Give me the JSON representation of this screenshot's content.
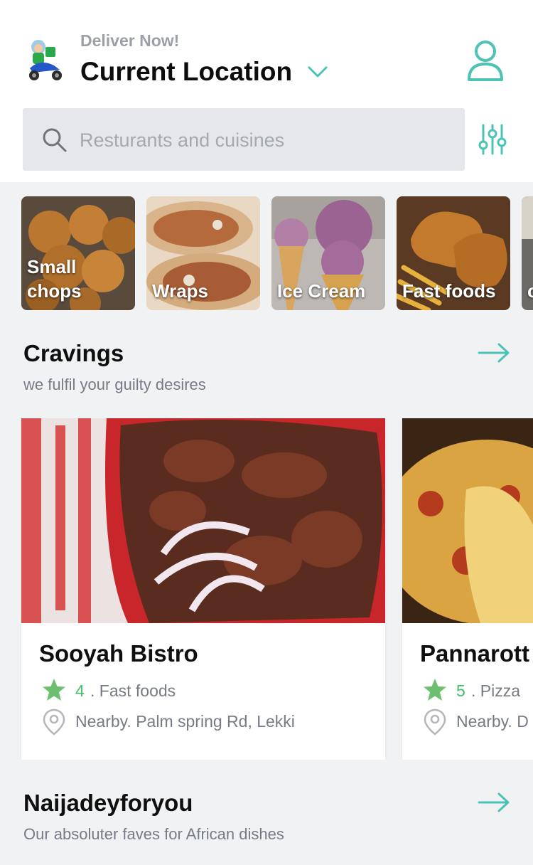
{
  "header": {
    "deliver_label": "Deliver Now!",
    "location_label": "Current Location"
  },
  "search": {
    "placeholder": "Resturants and cuisines"
  },
  "categories": [
    {
      "label": "Small chops"
    },
    {
      "label": "Wraps"
    },
    {
      "label": "Ice Cream"
    },
    {
      "label": "Fast foods"
    },
    {
      "label": "c c"
    }
  ],
  "sections": [
    {
      "title": "Cravings",
      "subtitle": "we fulfil your guilty desires",
      "restaurants": [
        {
          "name": "Sooyah Bistro",
          "rating": "4",
          "category": ". Fast foods",
          "address": "Nearby. Palm spring Rd, Lekki"
        },
        {
          "name": "Pannarott",
          "rating": "5",
          "category": ". Pizza",
          "address": "Nearby. D"
        }
      ]
    },
    {
      "title": "Naijadeyforyou",
      "subtitle": "Our absoluter faves for African dishes"
    }
  ],
  "colors": {
    "accent": "#4cc3b5",
    "rating_star": "#6cbf6e",
    "rating_text": "#3fbf6a",
    "muted_text": "#767b84",
    "search_bg": "#e6e7ea",
    "page_bg": "#f1f2f4"
  },
  "icons": {
    "rider": "delivery-rider-icon",
    "chevron": "chevron-down-icon",
    "profile": "user-profile-icon",
    "search": "search-icon",
    "filter": "filter-sliders-icon",
    "arrow": "arrow-right-icon",
    "star": "star-icon",
    "pin": "location-pin-icon"
  }
}
